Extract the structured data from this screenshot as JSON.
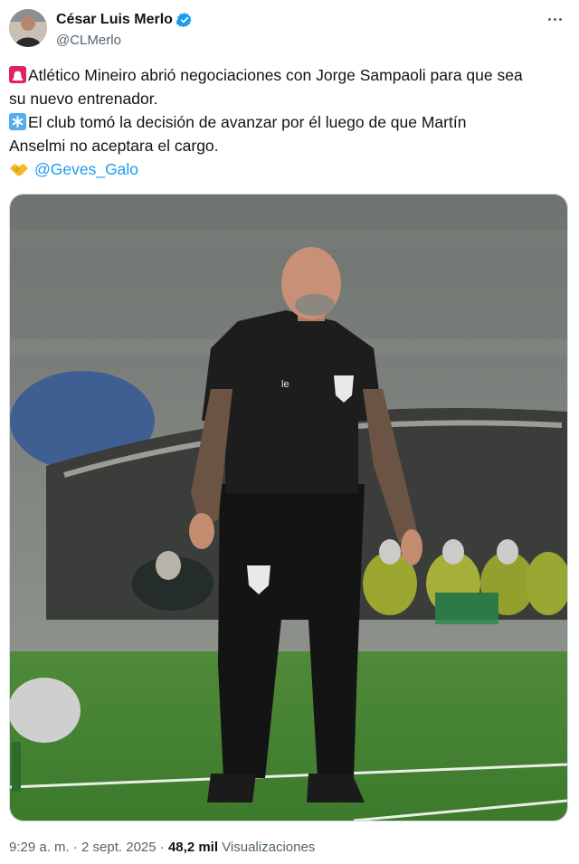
{
  "author": {
    "name": "César Luis Merlo",
    "handle": "@CLMerlo"
  },
  "tweet": {
    "line1_part1": "Atlético Mineiro abrió negociaciones con Jorge Sampaoli para que sea",
    "line1_part2": "su nuevo entrenador.",
    "line2_part1": "El club tomó la decisión de avanzar por él luego de que Martín",
    "line2_part2": "Anselmi no aceptara el cargo.",
    "mention": "@Geves_Galo"
  },
  "meta": {
    "time": "9:29 a. m.",
    "separator": "·",
    "date": "2 sept. 2025",
    "views_count": "48,2 mil",
    "views_label": "Visualizaciones"
  },
  "icons": {
    "verified": "verified-badge-icon",
    "more": "more-options-icon",
    "siren": "rotating-light-emoji",
    "asterisk": "asterisk-emoji",
    "handshake": "handshake-emoji"
  },
  "colors": {
    "link": "#1d9bf0",
    "secondary": "#536471",
    "verified": "#1d9bf0"
  }
}
